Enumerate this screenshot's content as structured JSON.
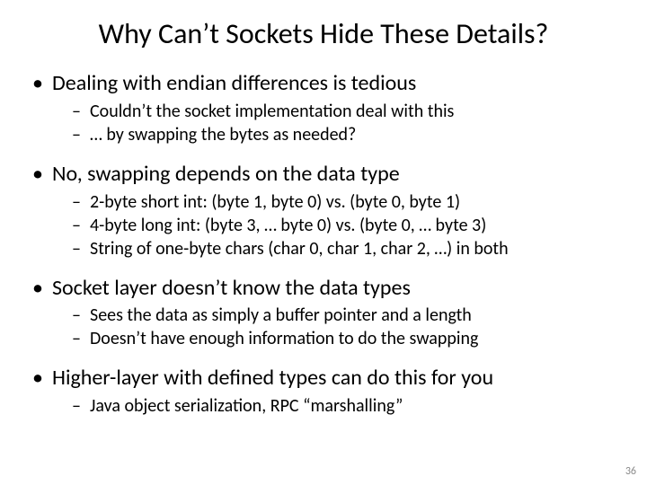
{
  "title": "Why Can’t Sockets Hide These Details?",
  "groups": [
    {
      "lvl1": "Dealing with endian differences is tedious",
      "subs": [
        "Couldn’t the socket implementation deal with this",
        "… by swapping the bytes as needed?"
      ]
    },
    {
      "lvl1": "No, swapping depends on the data type",
      "subs": [
        "2-byte short int: (byte 1, byte 0) vs. (byte 0, byte 1)",
        "4-byte long int:  (byte 3, … byte 0) vs. (byte 0, … byte 3)",
        "String of one-byte chars  (char 0, char 1, char 2, …) in both"
      ]
    },
    {
      "lvl1": "Socket layer doesn’t know the data types",
      "subs": [
        "Sees the data as simply a buffer pointer and a length",
        "Doesn’t have enough information to do the swapping"
      ]
    },
    {
      "lvl1": "Higher-layer with defined types can do this for you",
      "subs": [
        "Java object serialization, RPC “marshalling”"
      ]
    }
  ],
  "page_number": "36"
}
